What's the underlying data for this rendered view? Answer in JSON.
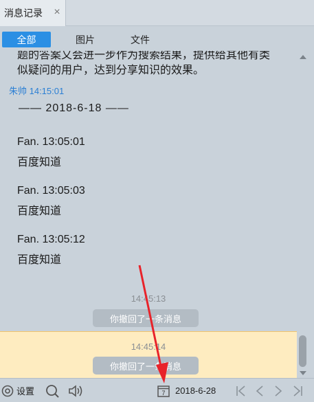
{
  "tab": {
    "title": "消息记录",
    "close_glyph": "×"
  },
  "filters": {
    "all": "全部",
    "images": "图片",
    "files": "文件"
  },
  "history": {
    "partial_text_1": "题的答案又会进一步作为搜索结果，提供给其他有类",
    "partial_text_2": "似疑问的用户，达到分享知识的效果。",
    "sender_line": "朱帅 14:15:01",
    "date_separator": "—— 2018-6-18 ——",
    "entries": [
      {
        "name": "Fan.  13:05:01",
        "text": "百度知道"
      },
      {
        "name": "Fan.  13:05:03",
        "text": "百度知道"
      },
      {
        "name": "Fan.  13:05:12",
        "text": "百度知道"
      }
    ],
    "recalls": [
      {
        "time": "14:45:13",
        "label": "你撤回了一条消息"
      },
      {
        "time": "14:45:14",
        "label": "你撤回了一条消息"
      }
    ]
  },
  "bottom": {
    "settings_label": "设置",
    "date": "2018-6-28",
    "calendar_day": "7"
  },
  "colors": {
    "accent": "#2b8fe4",
    "sender": "#2b7fd4",
    "highlight": "#feecc0",
    "arrow": "#e8232a"
  },
  "icons": [
    "close-icon",
    "scroll-up-icon",
    "scroll-down-icon",
    "settings-icon",
    "search-icon",
    "volume-icon",
    "calendar-icon",
    "first-page-icon",
    "prev-page-icon",
    "next-page-icon",
    "last-page-icon"
  ]
}
